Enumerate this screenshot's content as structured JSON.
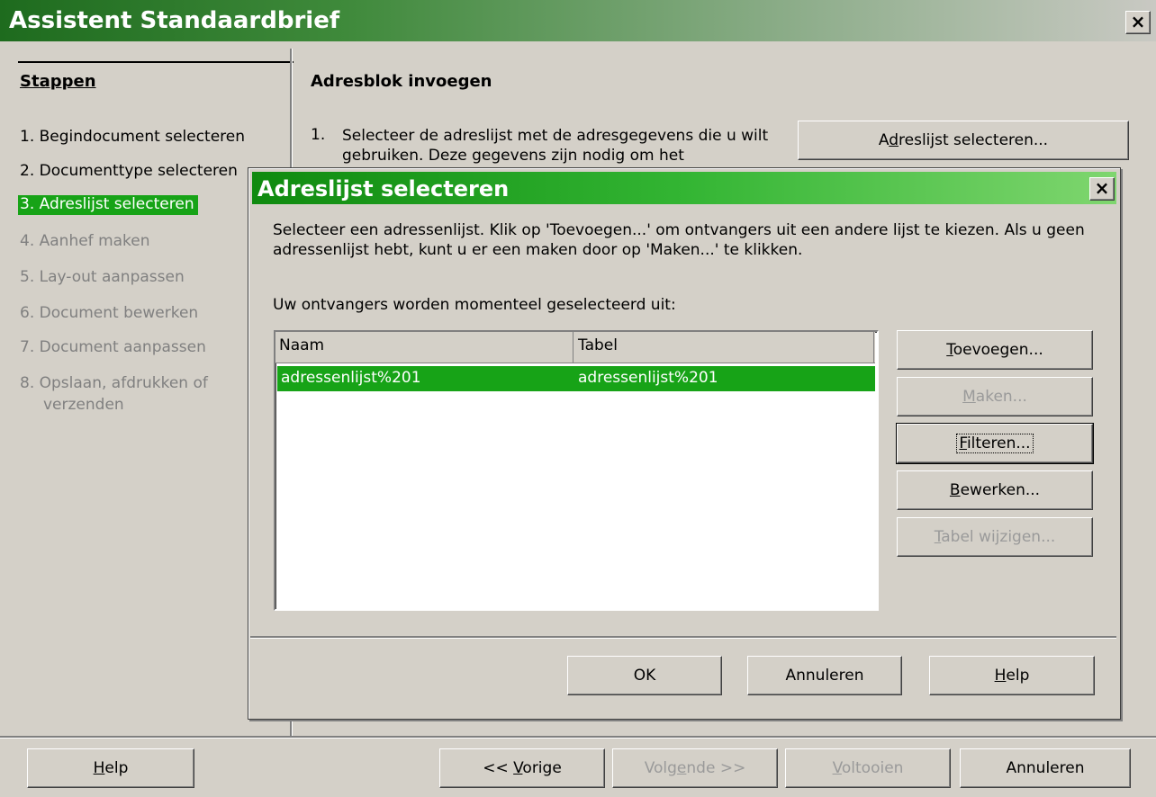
{
  "window": {
    "title": "Assistent Standaardbrief",
    "close_label": "×"
  },
  "steps": {
    "heading": "Stappen",
    "items": [
      {
        "label": "1. Begindocument selecteren"
      },
      {
        "label": "2. Documenttype selecteren"
      },
      {
        "label": "3. Adreslijst selecteren"
      },
      {
        "label": "4. Aanhef maken"
      },
      {
        "label": "5. Lay-out aanpassen"
      },
      {
        "label": "6. Document bewerken"
      },
      {
        "label": "7. Document aanpassen"
      },
      {
        "label": "8. Opslaan, afdrukken of"
      },
      {
        "label": "verzenden"
      }
    ]
  },
  "content": {
    "title": "Adresblok invoegen",
    "instruction_number": "1.",
    "instruction_text": "Selecteer de adreslijst met de adresgegevens die u wilt gebruiken. Deze gegevens zijn nodig om het",
    "select_list_button": {
      "pre": "A",
      "u": "d",
      "post": "reslijst selecteren..."
    }
  },
  "dialog": {
    "title": "Adreslijst selecteren",
    "close_label": "×",
    "description": "Selecteer een adressenlijst. Klik op 'Toevoegen...' om ontvangers uit een andere lijst te kiezen. Als u geen adressenlijst hebt, kunt u er een maken door op 'Maken...' te klikken.",
    "from_label": "Uw ontvangers worden momenteel geselecteerd uit:",
    "columns": [
      "Naam",
      "Tabel"
    ],
    "rows": [
      {
        "name": "adressenlijst%201",
        "table": "adressenlijst%201"
      }
    ],
    "buttons": {
      "add": {
        "u": "T",
        "post": "oevoegen..."
      },
      "create": {
        "u": "M",
        "post": "aken..."
      },
      "filter": {
        "u": "F",
        "post": "ilteren..."
      },
      "edit": {
        "u": "B",
        "post": "ewerken..."
      },
      "change_table": {
        "u": "T",
        "post": "abel wijzigen..."
      },
      "ok": "OK",
      "cancel": "Annuleren",
      "help": {
        "u": "H",
        "post": "elp"
      }
    }
  },
  "footer": {
    "help": {
      "u": "H",
      "post": "elp"
    },
    "previous": {
      "pre": "<< ",
      "u": "V",
      "post": "orige"
    },
    "next": {
      "pre": "Volg",
      "u": "e",
      "post": "nde >>"
    },
    "finish": {
      "u": "V",
      "post": "oltooien"
    },
    "cancel": "Annuleren"
  }
}
